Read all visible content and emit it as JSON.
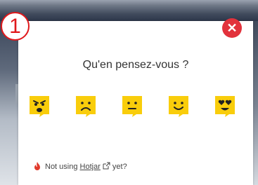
{
  "badge": {
    "number": "1",
    "color": "#e0181b"
  },
  "dialog": {
    "close_icon": "close-icon",
    "close_color": "#e2323c",
    "title": "Qu'en pensez-vous ?",
    "face_color": "#f9cd0b",
    "faces": [
      {
        "icon": "angry-face-icon"
      },
      {
        "icon": "sad-face-icon"
      },
      {
        "icon": "neutral-face-icon"
      },
      {
        "icon": "smile-face-icon"
      },
      {
        "icon": "heart-eyes-face-icon"
      }
    ]
  },
  "footer": {
    "prefix": "Not using",
    "link": "Hotjar",
    "suffix": "yet?",
    "flame_color": "#e13a2c"
  }
}
